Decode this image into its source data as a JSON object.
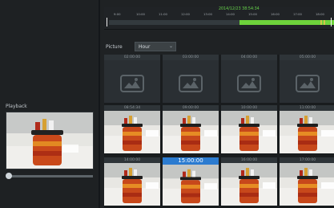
{
  "playback": {
    "title": "Playback"
  },
  "timeline": {
    "date_text": "2014/12/23 38:54:34",
    "ticks": [
      "9:00",
      "10:00",
      "11:00",
      "12:00",
      "13:00",
      "14:00",
      "15:00",
      "16:00",
      "17:00",
      "18:00"
    ],
    "recorded_color": "#6dd23b"
  },
  "filter": {
    "label": "Picture",
    "select_value": "Hour"
  },
  "grid": {
    "rows": [
      [
        "02:00:00",
        "03:00:00",
        "04:00:00",
        "05:00:00"
      ],
      [
        "08:54:34",
        "09:00:00",
        "10:00:00",
        "11:00:00"
      ],
      [
        "14:00:00",
        "15:00:00",
        "16:00:00",
        "17:00:00"
      ]
    ],
    "selected_label": "15:00:00",
    "selected_color": "#2b7bd0"
  },
  "icons": [
    "image-placeholder-icon",
    "chevron-down-icon"
  ]
}
